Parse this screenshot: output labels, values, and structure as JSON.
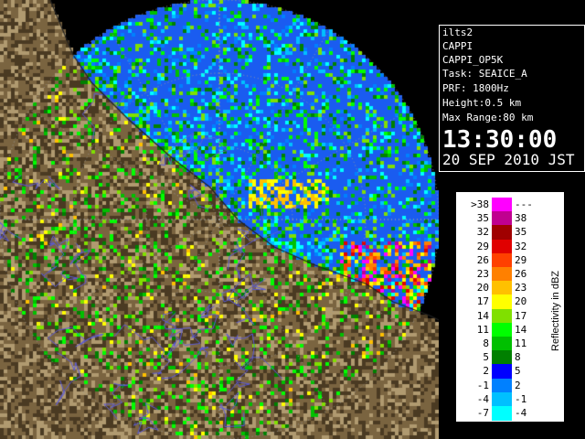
{
  "info": {
    "lines": [
      "ilts2",
      "CAPPI",
      "CAPPI_OP5K",
      "Task: SEAICE_A",
      "PRF: 1800Hz",
      "Height:0.5 km",
      "Max Range:80 km"
    ],
    "time": "13:30:00",
    "date": "20 SEP 2010 JST"
  },
  "legend": {
    "axis_label": "Reflectivity in dBZ",
    "rows": [
      {
        "low": ">38",
        "high": "---",
        "color": "#ff00ff"
      },
      {
        "low": "35",
        "high": "38",
        "color": "#c00090"
      },
      {
        "low": "32",
        "high": "35",
        "color": "#a00000"
      },
      {
        "low": "29",
        "high": "32",
        "color": "#e00000"
      },
      {
        "low": "26",
        "high": "29",
        "color": "#ff4000"
      },
      {
        "low": "23",
        "high": "26",
        "color": "#ff8000"
      },
      {
        "low": "20",
        "high": "23",
        "color": "#ffc000"
      },
      {
        "low": "17",
        "high": "20",
        "color": "#ffff00"
      },
      {
        "low": "14",
        "high": "17",
        "color": "#80e000"
      },
      {
        "low": "11",
        "high": "14",
        "color": "#00ff00"
      },
      {
        "low": "8",
        "high": "11",
        "color": "#00c000"
      },
      {
        "low": "5",
        "high": "8",
        "color": "#008000"
      },
      {
        "low": "2",
        "high": "5",
        "color": "#0000ff"
      },
      {
        "low": "-1",
        "high": "2",
        "color": "#0080ff"
      },
      {
        "low": "-4",
        "high": "-1",
        "color": "#00c0ff"
      },
      {
        "low": "-7",
        "high": "-4",
        "color": "#00ffff"
      }
    ]
  },
  "radar": {
    "colors": {
      "background": "#000000",
      "sea": "#1a5cf0",
      "land_dark": "#4a3a22",
      "land_mid": "#7a6440",
      "land_light": "#b09a70",
      "rivers": "#5a5ad8",
      "grid": "#9a9a9a"
    }
  }
}
